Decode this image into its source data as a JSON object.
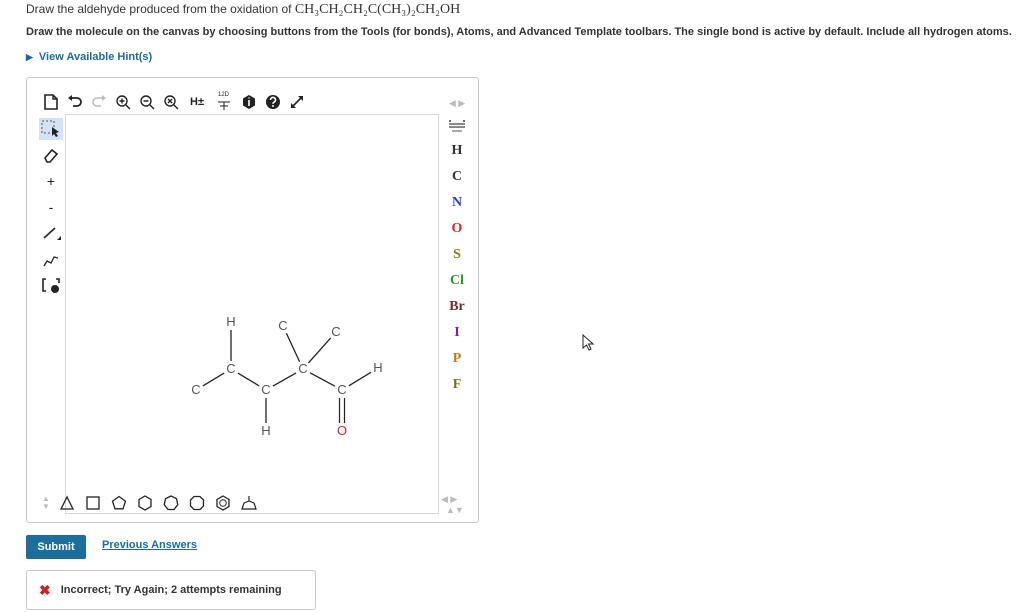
{
  "question": {
    "prompt_prefix": "Draw the aldehyde produced from the oxidation of",
    "formula": "CH₃CH₂CH₂C(CH₃)₂CH₂OH",
    "instructions": "Draw the molecule on the canvas by choosing buttons from the Tools (for bonds), Atoms, and Advanced Template toolbars. The single bond is active by default. Include all hydrogen atoms.",
    "hints_link": "View Available Hint(s)"
  },
  "toolbar_top": {
    "icons": [
      "new-document-icon",
      "undo-icon",
      "redo-icon",
      "zoom-in-icon",
      "zoom-out-icon",
      "zoom-reset-icon",
      "hydrogen-toggle-icon",
      "stereo-label-icon",
      "info-icon",
      "help-icon",
      "fullscreen-icon"
    ],
    "h_label": "H±",
    "stereo_label": "12D"
  },
  "toolbar_left": {
    "items": [
      "selection-tool-icon",
      "eraser-icon",
      "positive-charge-icon",
      "negative-charge-icon",
      "single-bond-icon",
      "chain-tool-icon",
      "bracket-tool-icon"
    ],
    "plus": "+",
    "minus": "-"
  },
  "atoms": [
    {
      "symbol": "H",
      "color": "#333333"
    },
    {
      "symbol": "C",
      "color": "#333333"
    },
    {
      "symbol": "N",
      "color": "#2840c8"
    },
    {
      "symbol": "O",
      "color": "#e02020"
    },
    {
      "symbol": "S",
      "color": "#8a7a1a"
    },
    {
      "symbol": "Cl",
      "color": "#1f9a1f"
    },
    {
      "symbol": "Br",
      "color": "#7a2a2a"
    },
    {
      "symbol": "I",
      "color": "#8a1aa8"
    },
    {
      "symbol": "P",
      "color": "#c07a10"
    },
    {
      "symbol": "F",
      "color": "#8a6a1a"
    }
  ],
  "molecule": {
    "atoms": [
      {
        "label": "C",
        "color": "#555555"
      },
      {
        "label": "C",
        "color": "#555555"
      },
      {
        "label": "H",
        "color": "#555555"
      },
      {
        "label": "C",
        "color": "#555555"
      },
      {
        "label": "H",
        "color": "#555555"
      },
      {
        "label": "C",
        "color": "#555555"
      },
      {
        "label": "C",
        "color": "#555555"
      },
      {
        "label": "C",
        "color": "#555555"
      },
      {
        "label": "C",
        "color": "#555555"
      },
      {
        "label": "O",
        "color": "#e02020"
      },
      {
        "label": "H",
        "color": "#555555"
      }
    ]
  },
  "toolbar_bottom": {
    "icons": [
      "triangle-template-icon",
      "square-template-icon",
      "pentagon-template-icon",
      "hexagon-template-icon",
      "heptagon-template-icon",
      "octagon-template-icon",
      "benzene-template-icon",
      "custom-template-icon"
    ]
  },
  "actions": {
    "submit": "Submit",
    "previous_answers": "Previous Answers"
  },
  "feedback": {
    "text": "Incorrect; Try Again; 2 attempts remaining"
  }
}
